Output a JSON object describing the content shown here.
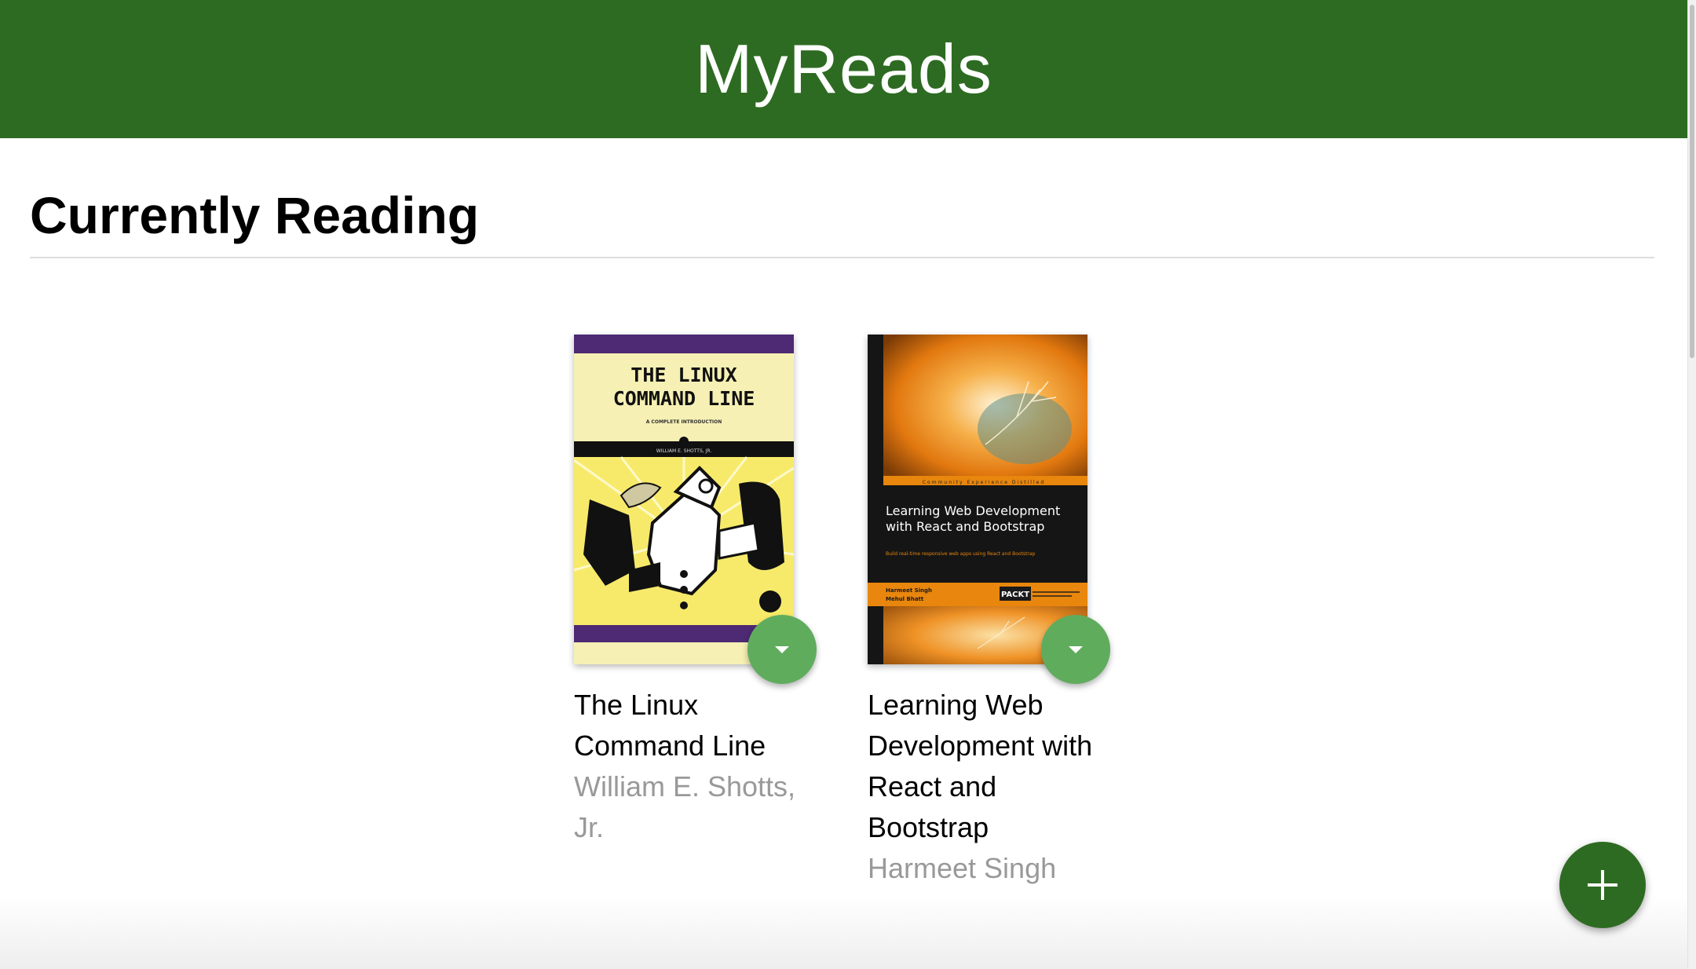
{
  "app": {
    "title": "MyReads"
  },
  "shelf": {
    "title": "Currently Reading"
  },
  "books": [
    {
      "title": "The Linux Command Line",
      "authors": "William E. Shotts, Jr.",
      "cover": {
        "title_line1": "THE LINUX",
        "title_line2": "COMMAND LINE",
        "subtitle": "A COMPLETE INTRODUCTION",
        "author_strip": "WILLIAM E. SHOTTS, JR."
      }
    },
    {
      "title": "Learning Web Development with React and Bootstrap",
      "authors": "Harmeet Singh",
      "cover": {
        "banner": "Community Experience Distilled",
        "title_line1": "Learning Web Development",
        "title_line2": "with React and Bootstrap",
        "tagline": "Build real-time responsive web apps using React and Bootstrap",
        "author1": "Harmeet Singh",
        "author2": "Mehul Bhatt",
        "publisher": "PACKT"
      }
    }
  ],
  "buttons": {
    "shelf_changer_icon": "caret-down-icon",
    "open_search_icon": "plus-icon"
  },
  "colors": {
    "header": "#2e6b22",
    "shelf_changer": "#60ac5d",
    "open_search": "#2e6b22",
    "author_text": "#999999"
  }
}
